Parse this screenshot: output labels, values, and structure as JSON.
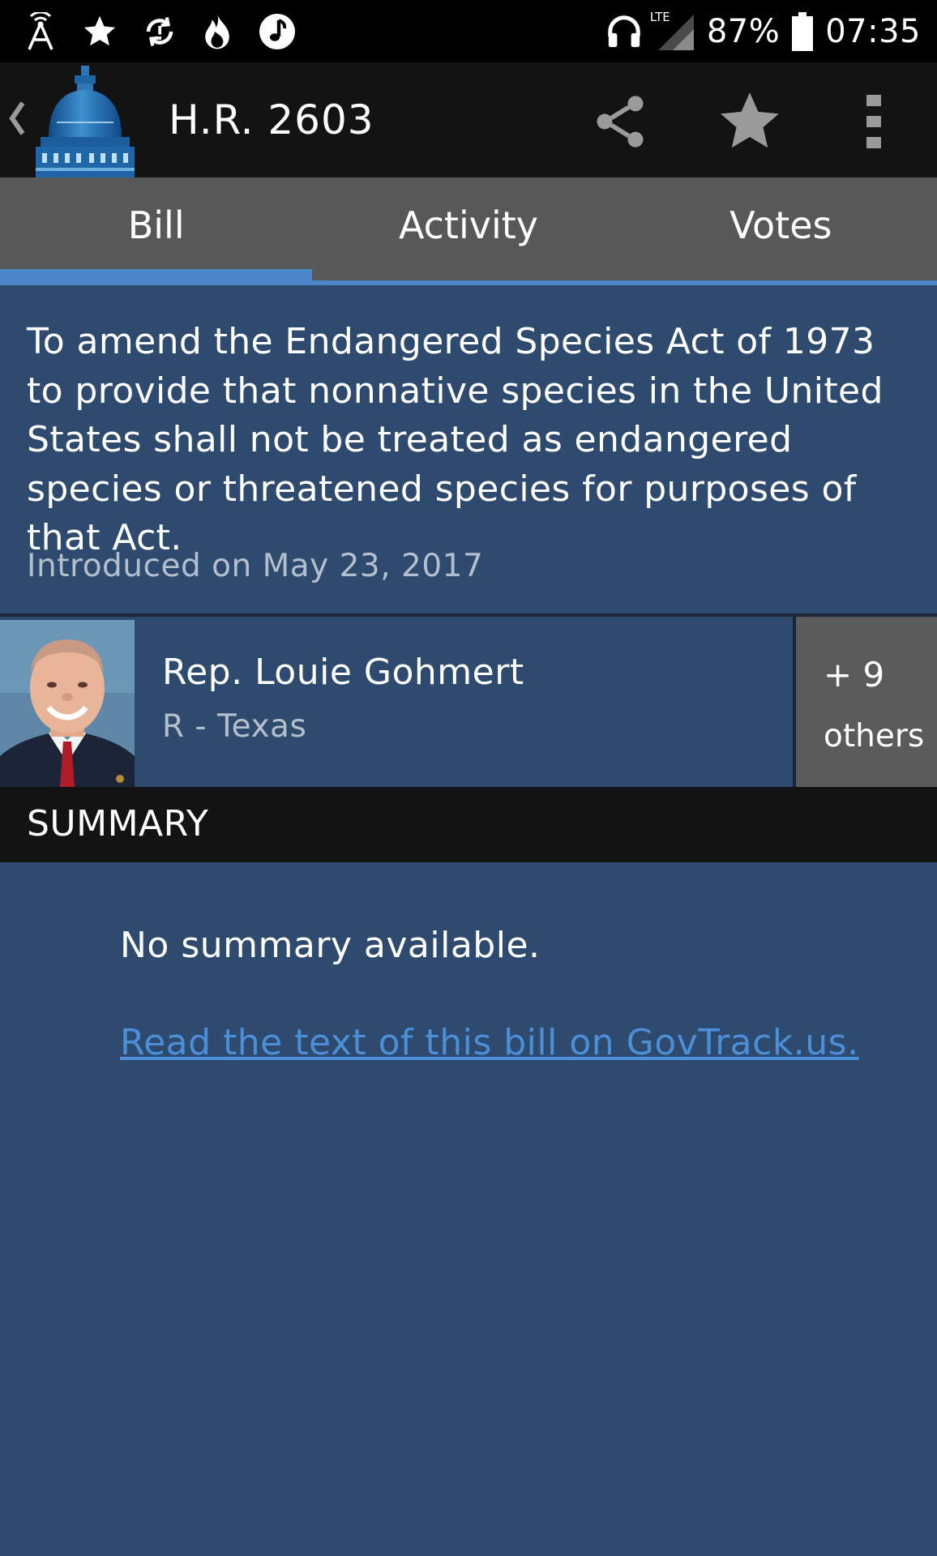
{
  "status_bar": {
    "battery": "87%",
    "time": "07:35",
    "network": "LTE",
    "icons_left": [
      "signal-tower-icon",
      "star-icon",
      "sync-icon",
      "flame-icon",
      "music-note-icon"
    ],
    "icons_right": [
      "headphones-icon",
      "cell-signal-icon",
      "battery-icon"
    ]
  },
  "app_bar": {
    "title": "H.R. 2603",
    "logo": "capitol-dome-logo",
    "actions": [
      "share-icon",
      "star-icon",
      "overflow-menu-icon"
    ]
  },
  "tabs": [
    {
      "label": "Bill",
      "active": true
    },
    {
      "label": "Activity",
      "active": false
    },
    {
      "label": "Votes",
      "active": false
    }
  ],
  "bill": {
    "description": "To amend the Endangered Species Act of 1973 to provide that nonnative species in the United States shall not be treated as endangered species or threatened species for purposes of that Act.",
    "introduced": "Introduced on May 23, 2017"
  },
  "sponsor": {
    "name": "Rep. Louie Gohmert",
    "party_state": "R - Texas",
    "others_count": "+ 9",
    "others_label": "others"
  },
  "summary": {
    "header": "SUMMARY",
    "text": "No summary available.",
    "link_text": "Read the text of this bill on GovTrack.us."
  },
  "colors": {
    "background": "#2e4a6e",
    "app_bar": "#131313",
    "tab_bar": "#585858",
    "accent": "#4a86c8",
    "muted_text": "#b4bfcd",
    "link": "#4a8fd8"
  }
}
